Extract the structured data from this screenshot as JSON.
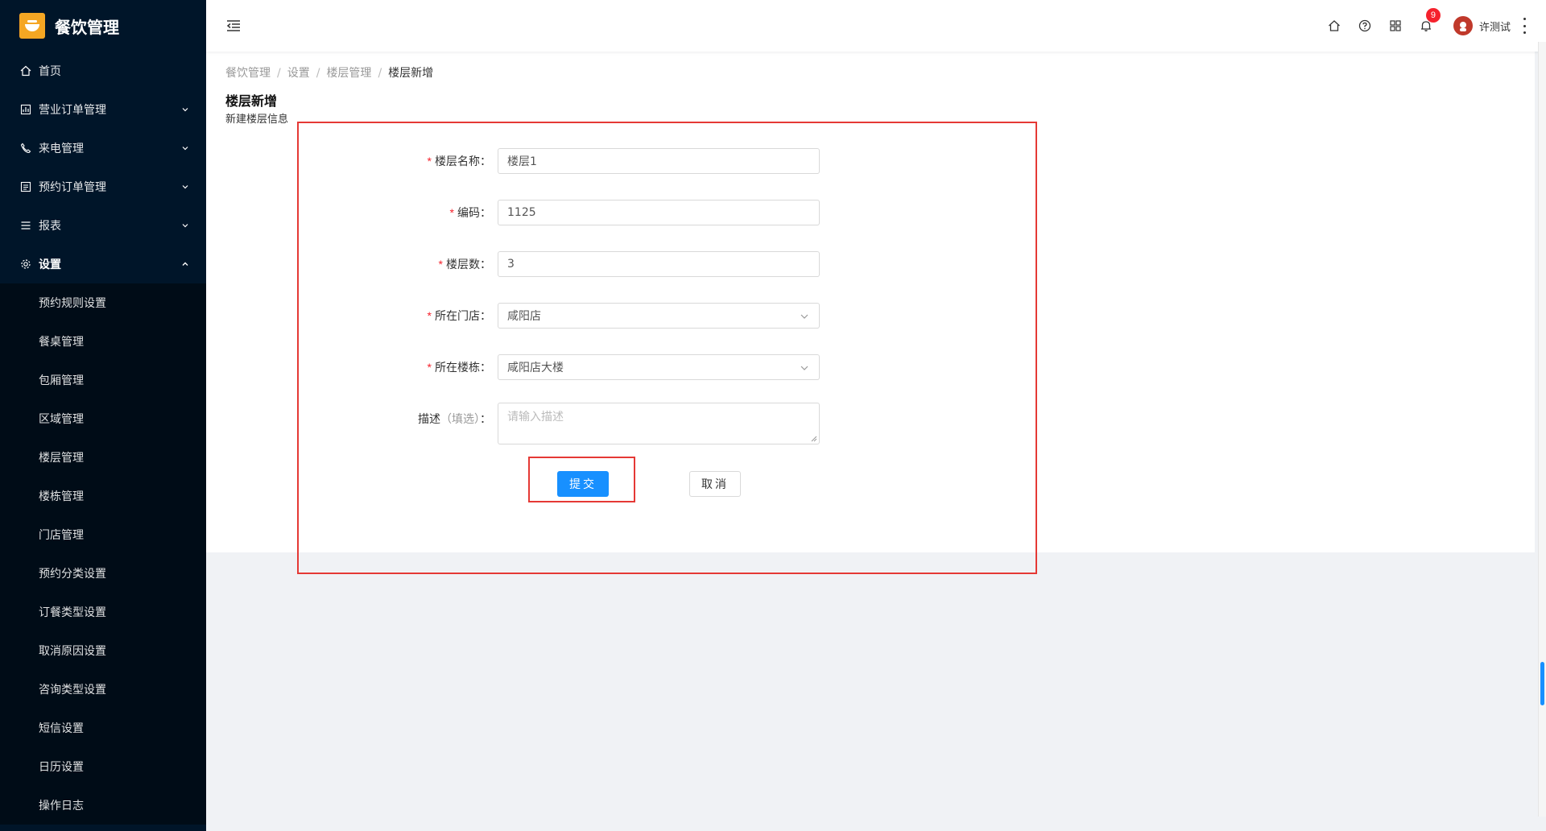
{
  "app": {
    "title": "餐饮管理"
  },
  "sidebar": {
    "items": [
      {
        "label": "首页",
        "icon": "home-icon",
        "expandable": false
      },
      {
        "label": "营业订单管理",
        "icon": "chart-icon",
        "expandable": true
      },
      {
        "label": "来电管理",
        "icon": "phone-icon",
        "expandable": true
      },
      {
        "label": "预约订单管理",
        "icon": "list-icon",
        "expandable": true
      },
      {
        "label": "报表",
        "icon": "menu-lines-icon",
        "expandable": true
      },
      {
        "label": "设置",
        "icon": "gear-icon",
        "expandable": true,
        "open": true
      }
    ],
    "submenu": [
      "预约规则设置",
      "餐桌管理",
      "包厢管理",
      "区域管理",
      "楼层管理",
      "楼栋管理",
      "门店管理",
      "预约分类设置",
      "订餐类型设置",
      "取消原因设置",
      "咨询类型设置",
      "短信设置",
      "日历设置",
      "操作日志"
    ]
  },
  "header": {
    "notification_count": "9",
    "user_name": "许测试"
  },
  "breadcrumb": [
    "餐饮管理",
    "设置",
    "楼层管理",
    "楼层新增"
  ],
  "page": {
    "title": "楼层新增",
    "description": "新建楼层信息"
  },
  "form": {
    "floor_name": {
      "label": "楼层名称：",
      "value": "楼层1"
    },
    "code": {
      "label": "编码：",
      "value": "1125"
    },
    "floor_count": {
      "label": "楼层数：",
      "value": "3"
    },
    "store": {
      "label": "所在门店：",
      "value": "咸阳店"
    },
    "building": {
      "label": "所在楼栋：",
      "value": "咸阳店大楼"
    },
    "description": {
      "label": "描述",
      "optional": "（填选）",
      "colon": "：",
      "placeholder": "请输入描述"
    },
    "submit_label": "提交",
    "cancel_label": "取消"
  },
  "colors": {
    "primary": "#1890ff",
    "sidebar_bg": "#001529",
    "required": "#f5222d",
    "highlight": "#e53935"
  }
}
